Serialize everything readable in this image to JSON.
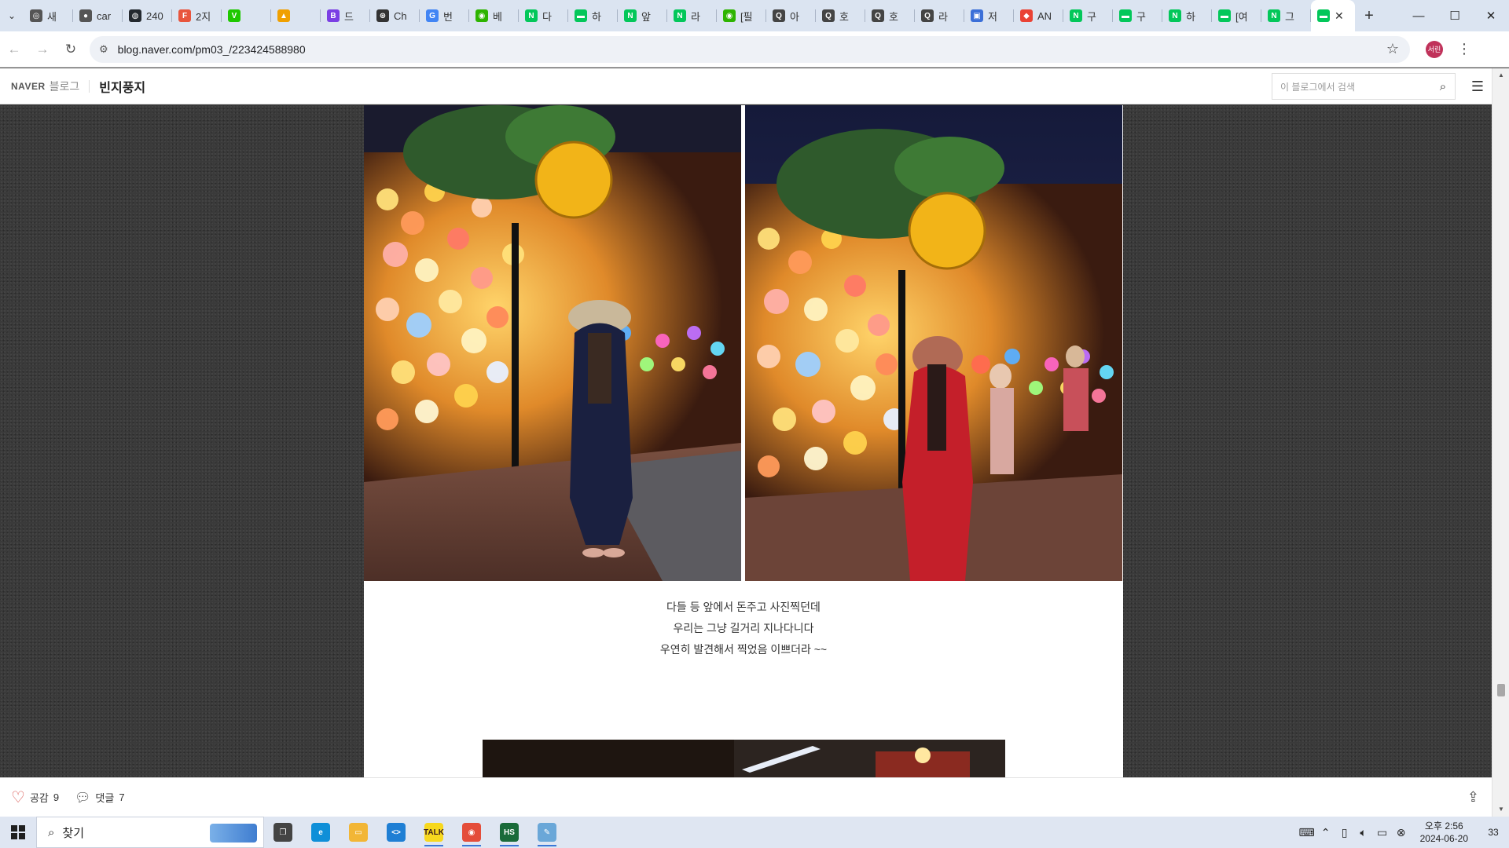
{
  "browser": {
    "tabs": [
      {
        "title": "새",
        "fav_color": "#555555",
        "fav": "◎"
      },
      {
        "title": "car",
        "fav_color": "#555555",
        "fav": "●"
      },
      {
        "title": "240",
        "fav_color": "#24292f",
        "fav": "◍"
      },
      {
        "title": "2지",
        "fav_color": "#e8553d",
        "fav": "F"
      },
      {
        "title": "",
        "fav_color": "#1ec800",
        "fav": "V"
      },
      {
        "title": "",
        "fav_color": "#f0a000",
        "fav": "▲"
      },
      {
        "title": "드",
        "fav_color": "#7b3fe4",
        "fav": "B"
      },
      {
        "title": "Ch",
        "fav_color": "#333333",
        "fav": "⊛"
      },
      {
        "title": "번",
        "fav_color": "#4285f4",
        "fav": "G"
      },
      {
        "title": "베",
        "fav_color": "#2db400",
        "fav": "◉"
      },
      {
        "title": "다",
        "fav_color": "#03c75a",
        "fav": "N"
      },
      {
        "title": "하",
        "fav_color": "#03c75a",
        "fav": "▬"
      },
      {
        "title": "앞",
        "fav_color": "#03c75a",
        "fav": "N"
      },
      {
        "title": "라",
        "fav_color": "#03c75a",
        "fav": "N"
      },
      {
        "title": "[필",
        "fav_color": "#2db400",
        "fav": "◉"
      },
      {
        "title": "아",
        "fav_color": "#444444",
        "fav": "Q"
      },
      {
        "title": "호",
        "fav_color": "#444444",
        "fav": "Q"
      },
      {
        "title": "호",
        "fav_color": "#444444",
        "fav": "Q"
      },
      {
        "title": "라",
        "fav_color": "#444444",
        "fav": "Q"
      },
      {
        "title": "저",
        "fav_color": "#3b6fd8",
        "fav": "▣"
      },
      {
        "title": "AN",
        "fav_color": "#ea4335",
        "fav": "◆"
      },
      {
        "title": "구",
        "fav_color": "#03c75a",
        "fav": "N"
      },
      {
        "title": "구",
        "fav_color": "#03c75a",
        "fav": "▬"
      },
      {
        "title": "하",
        "fav_color": "#03c75a",
        "fav": "N"
      },
      {
        "title": "[여",
        "fav_color": "#03c75a",
        "fav": "▬"
      },
      {
        "title": "그",
        "fav_color": "#03c75a",
        "fav": "N"
      }
    ],
    "active_tab": {
      "fav_color": "#03c75a",
      "fav": "▬",
      "close": "✕"
    },
    "new_tab": "+",
    "url": "blog.naver.com/pm03_/223424588980",
    "profile_label": "서린"
  },
  "blog": {
    "logo": "NAVER",
    "blog_word": "블로그",
    "name": "빈지풍지",
    "search_placeholder": "이 블로그에서 검색"
  },
  "post": {
    "caption_lines": [
      "다들 등 앞에서 돈주고 사진찍던데",
      "우리는 그냥 길거리 지나다니다",
      "우연히 발견해서 찍었음 이쁘더라 ~~"
    ]
  },
  "actions": {
    "like_label": "공감",
    "like_count": "9",
    "comment_label": "댓글",
    "comment_count": "7"
  },
  "taskbar": {
    "search_label": "찾기",
    "apps": [
      {
        "name": "task-view",
        "color": "#444444",
        "glyph": "❐",
        "running": false
      },
      {
        "name": "edge",
        "color": "#0f8fd8",
        "glyph": "e",
        "running": false
      },
      {
        "name": "file-explorer",
        "color": "#f2b636",
        "glyph": "▭",
        "running": false
      },
      {
        "name": "vscode",
        "color": "#1f7fd4",
        "glyph": "<>",
        "running": false
      },
      {
        "name": "kakaotalk",
        "color": "#f7d81e",
        "glyph": "TALK",
        "running": true
      },
      {
        "name": "chrome",
        "color": "#e44d3a",
        "glyph": "◉",
        "running": true
      },
      {
        "name": "hs-app",
        "color": "#1a6b3a",
        "glyph": "HS",
        "running": true
      },
      {
        "name": "notepad",
        "color": "#6aa7d8",
        "glyph": "✎",
        "running": true
      }
    ],
    "time": "오후 2:56",
    "date": "2024-06-20",
    "notification_count": "33"
  }
}
